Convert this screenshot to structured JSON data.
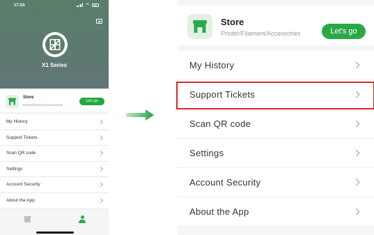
{
  "small_phone": {
    "status_time": "17:24",
    "series_label": "X1 Series",
    "store": {
      "title": "Store",
      "subtitle": "Printer/Filament/Accessories",
      "button": "Let's go"
    },
    "menu": [
      {
        "label": "My History"
      },
      {
        "label": "Support Tickets"
      },
      {
        "label": "Scan QR code"
      },
      {
        "label": "Settings"
      },
      {
        "label": "Account Security"
      },
      {
        "label": "About the App"
      }
    ]
  },
  "zoomed_panel": {
    "store": {
      "title": "Store",
      "subtitle": "Printer/Filament/Accessories",
      "button": "Let's go"
    },
    "menu": [
      {
        "label": "My History"
      },
      {
        "label": "Support Tickets"
      },
      {
        "label": "Scan QR code"
      },
      {
        "label": "Settings"
      },
      {
        "label": "Account Security"
      },
      {
        "label": "About the App"
      }
    ],
    "highlighted_item": "Support Tickets"
  },
  "colors": {
    "accent": "#2aa847",
    "highlight": "#d9262a",
    "hero": "#5d7a70"
  },
  "icons": {
    "store": "storefront-icon",
    "chevron": "chevron-right-icon",
    "message": "message-icon"
  }
}
